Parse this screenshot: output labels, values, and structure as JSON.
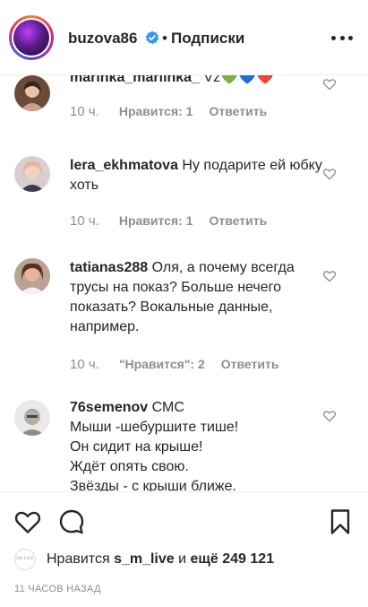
{
  "header": {
    "username": "buzova86",
    "separator": "•",
    "follow_label": "Подписки"
  },
  "comments": [
    {
      "username": "marinka_mariinka_",
      "text": " Vz💚💙❤️",
      "time": "10 ч.",
      "likes": "Нравится: 1",
      "reply": "Ответить"
    },
    {
      "username": "lera_ekhmatova",
      "text": " Ну подарите ей юбку хоть",
      "time": "10 ч.",
      "likes": "Нравится: 1",
      "reply": "Ответить"
    },
    {
      "username": "tatianas288",
      "text": " Оля, а почему всегда трусы на показ? Больше нечего показать? Вокальные данные, например.",
      "time": "10 ч.",
      "likes": "\"Нравится\": 2",
      "reply": "Ответить"
    },
    {
      "username": "76semenov",
      "lines": [
        " СМС",
        "Мыши -шебуршите тише!",
        "Он сидит на крыше!",
        "Ждёт опять свою.",
        "Звёзды - с крыши ближе."
      ]
    }
  ],
  "likes_row": {
    "avatar_text": "SM LIVE",
    "prefix": "Нравится",
    "user": "s_m_live",
    "connector": "и",
    "count": "ещё 249 121"
  },
  "timestamp": "11 ЧАСОВ НАЗАД",
  "icons": {
    "verified": "verified-badge-icon",
    "more": "more-options-icon",
    "comment_like": "heart-outline-icon",
    "like": "heart-outline-icon",
    "comment": "comment-bubble-icon",
    "save": "bookmark-icon"
  },
  "colors": {
    "verified": "#3897f0",
    "muted": "#8e8e8e",
    "text": "#262626"
  }
}
